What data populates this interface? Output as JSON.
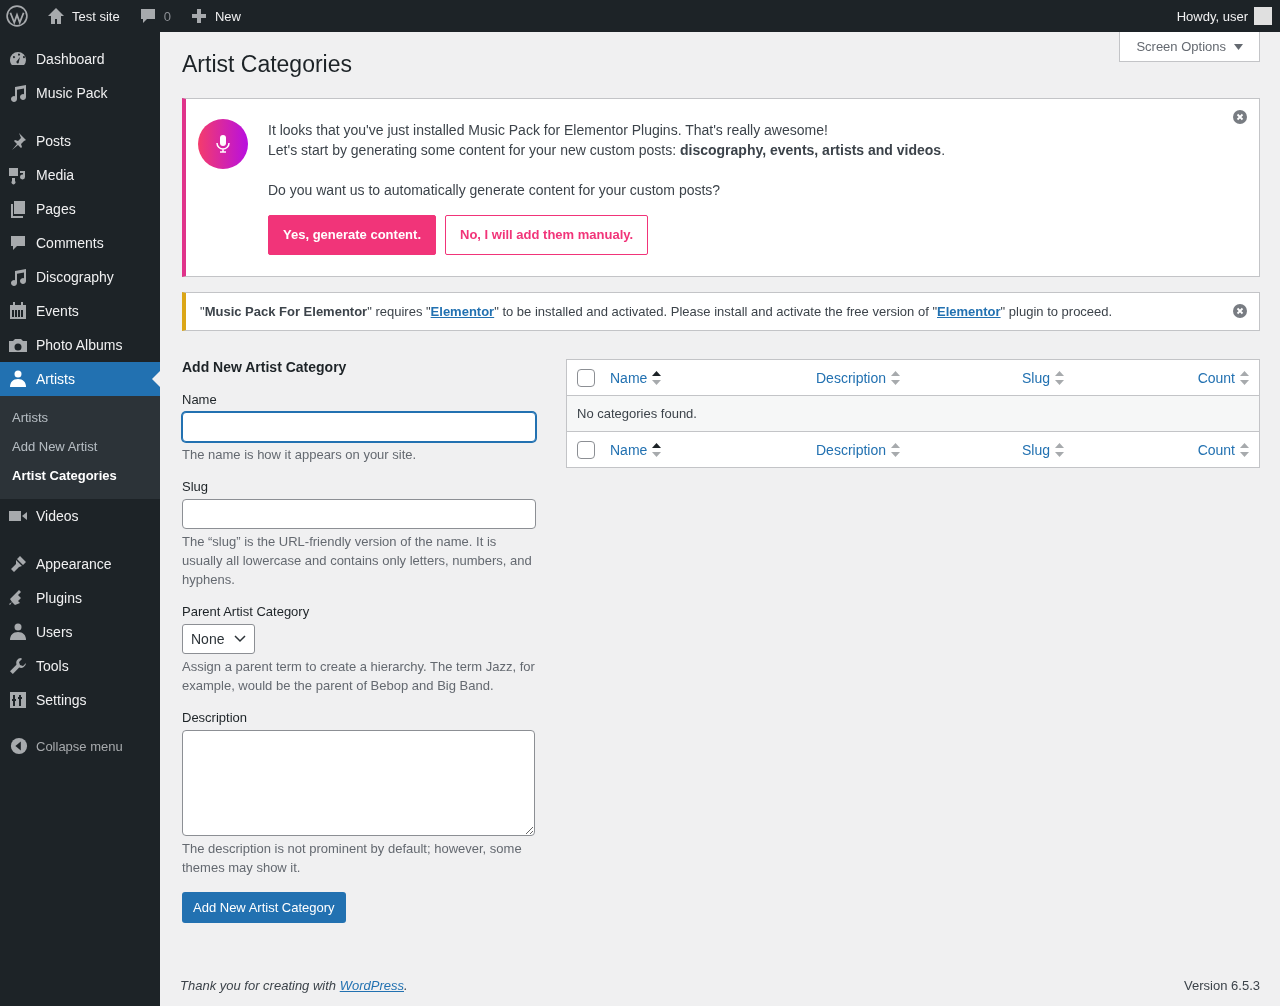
{
  "admin_bar": {
    "site": "Test site",
    "comments": "0",
    "new": "New",
    "greeting": "Howdy, user"
  },
  "sidebar": {
    "groups": [
      [
        {
          "label": "Dashboard",
          "selected": false
        },
        {
          "label": "Music Pack",
          "selected": false
        }
      ],
      [
        {
          "label": "Posts",
          "selected": false
        },
        {
          "label": "Media",
          "selected": false
        },
        {
          "label": "Pages",
          "selected": false
        },
        {
          "label": "Comments",
          "selected": false
        },
        {
          "label": "Discography",
          "selected": false
        },
        {
          "label": "Events",
          "selected": false
        },
        {
          "label": "Photo Albums",
          "selected": false
        },
        {
          "label": "Artists",
          "selected": true,
          "children": [
            {
              "label": "Artists",
              "selected": false
            },
            {
              "label": "Add New Artist",
              "selected": false
            },
            {
              "label": "Artist Categories",
              "selected": true
            }
          ]
        },
        {
          "label": "Videos",
          "selected": false
        }
      ],
      [
        {
          "label": "Appearance",
          "selected": false
        },
        {
          "label": "Plugins",
          "selected": false
        },
        {
          "label": "Users",
          "selected": false
        },
        {
          "label": "Tools",
          "selected": false
        },
        {
          "label": "Settings",
          "selected": false
        }
      ]
    ],
    "collapse": "Collapse menu"
  },
  "screen_options": "Screen Options",
  "page_title": "Artist Categories",
  "promo_notice": {
    "line_1": "It looks that you've just installed Music Pack for Elementor Plugins. That's really awesome!",
    "line_2": "Let's start by generating some content for your new custom posts: **discography, events, artists and videos**.",
    "question": "Do you want us to automatically generate content for your custom posts?",
    "buttons": [
      "Yes, generate content.",
      "No, I will add them manualy."
    ]
  },
  "warning_notice": {
    "parts": [
      {
        "kind": "text",
        "text": "\""
      },
      {
        "kind": "bold",
        "text": "Music Pack For Elementor"
      },
      {
        "kind": "text",
        "text": "\" requires \""
      },
      {
        "kind": "link",
        "text": "Elementor"
      },
      {
        "kind": "text",
        "text": "\" to be installed and activated. Please install and activate the free version of \""
      },
      {
        "kind": "link",
        "text": "Elementor"
      },
      {
        "kind": "text",
        "text": "\" plugin to proceed."
      }
    ]
  },
  "form": {
    "title": "Add New Artist Category",
    "fields": [
      {
        "kind": "text",
        "label": "Name",
        "focused": true,
        "help": "The name is how it appears on your site."
      },
      {
        "kind": "text",
        "label": "Slug",
        "focused": false,
        "help": "The “slug” is the URL-friendly version of the name. It is usually all lowercase and contains only letters, numbers, and hyphens."
      },
      {
        "kind": "select",
        "label": "Parent Artist Category",
        "value": "None",
        "help": "Assign a parent term to create a hierarchy. The term Jazz, for example, would be the parent of Bebop and Big Band."
      },
      {
        "kind": "textarea",
        "label": "Description",
        "help": "The description is not prominent by default; however, some themes may show it."
      }
    ],
    "submit": "Add New Artist Category"
  },
  "table": {
    "columns": [
      {
        "label": "Name",
        "sorted": true
      },
      {
        "label": "Description",
        "sorted": false
      },
      {
        "label": "Slug",
        "sorted": false
      },
      {
        "label": "Count",
        "sorted": false
      }
    ],
    "footer_columns": [
      {
        "label": "Name",
        "sorted": true
      },
      {
        "label": "Description",
        "sorted": false
      },
      {
        "label": "Slug",
        "sorted": false
      },
      {
        "label": "Count",
        "sorted": false
      }
    ],
    "empty_message": "No categories found.",
    "header_checked": false,
    "footer_checked": false
  },
  "footer": {
    "thanks": "Thank you for creating with ",
    "link": "WordPress",
    "end": ".",
    "version": "Version 6.5.3"
  }
}
